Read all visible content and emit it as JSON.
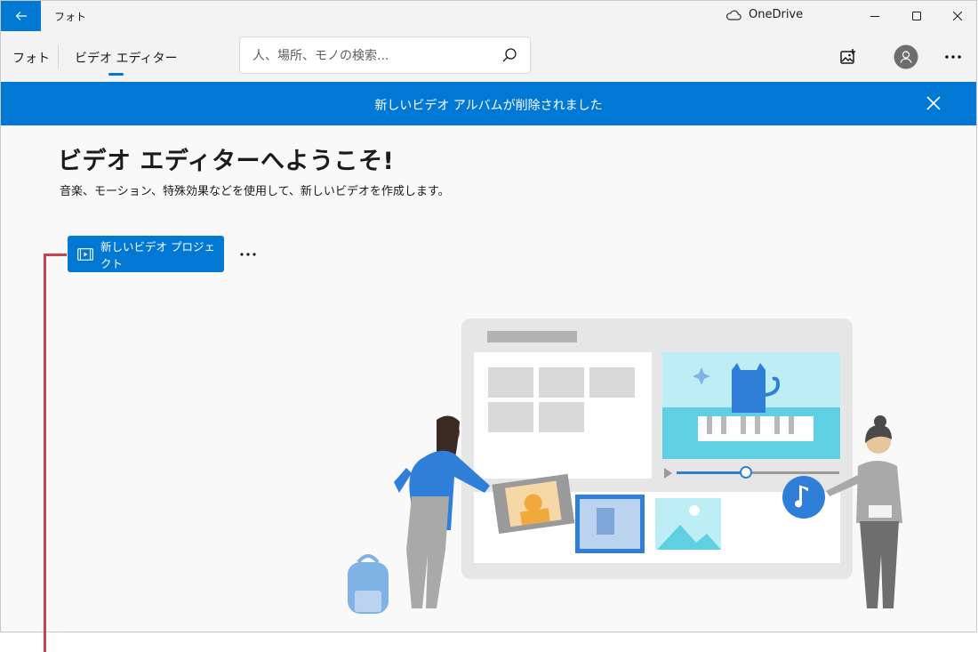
{
  "titlebar": {
    "app_title": "フォト",
    "onedrive_label": "OneDrive"
  },
  "toolbar": {
    "tabs": [
      {
        "label": "フォト"
      },
      {
        "label": "ビデオ エディター"
      }
    ],
    "search": {
      "placeholder": "人、場所、モノの検索...",
      "value": ""
    }
  },
  "banner": {
    "message": "新しいビデオ アルバムが削除されました"
  },
  "main": {
    "title": "ビデオ エディターへようこそ!",
    "subtitle": "音楽、モーション、特殊効果などを使用して、新しいビデオを作成します。",
    "new_project_label": "新しいビデオ プロジェクト"
  },
  "colors": {
    "accent": "#0078d4",
    "annotation": "#c8434a"
  }
}
